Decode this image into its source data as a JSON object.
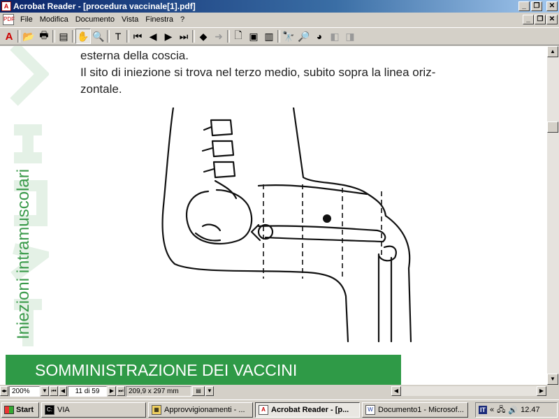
{
  "window": {
    "title": "Acrobat Reader - [procedura vaccinale[1].pdf]",
    "minimize": "_",
    "restore": "❐",
    "close": "✕"
  },
  "menu": {
    "items": [
      "File",
      "Modifica",
      "Documento",
      "Vista",
      "Finestra",
      "?"
    ]
  },
  "toolbar": {
    "icons": [
      "adobe-icon",
      "open-icon",
      "print-icon",
      "show-hide-navigation-icon",
      "hand-tool-icon",
      "zoom-tool-icon",
      "text-select-tool-icon",
      "first-page-icon",
      "previous-page-icon",
      "next-page-icon",
      "last-page-icon",
      "go-back-icon",
      "go-forward-icon",
      "actual-size-icon",
      "fit-page-icon",
      "fit-width-icon",
      "find-icon",
      "search-icon",
      "search-results-icon",
      "previous-highlight-icon",
      "next-highlight-icon"
    ]
  },
  "document": {
    "sidebar_title": "Iniezioni intramuscolari",
    "body_lines": [
      "esterna della coscia.",
      "Il sito di iniezione si trova nel terzo medio, subito sopra la linea oriz-",
      "zontale."
    ],
    "footer_banner": "SOMMINISTRAZIONE DEI VACCINI"
  },
  "status": {
    "zoom": "200%",
    "page": "11 di 59",
    "page_size": "209,9 x 297 mm"
  },
  "taskbar": {
    "start": "Start",
    "tasks": [
      {
        "label": "VIA",
        "icon": "console-icon"
      },
      {
        "label": "Approvvigionamenti - ...",
        "icon": "explorer-icon"
      },
      {
        "label": "Acrobat Reader - [p...",
        "icon": "acrobat-icon",
        "active": true
      },
      {
        "label": "Documento1 - Microsof...",
        "icon": "word-icon"
      }
    ],
    "lang": "IT",
    "clock": "12.47"
  },
  "colors": {
    "title_bar": "#0a246a",
    "brand_green": "#2f9a47",
    "chrome": "#d4d0c8"
  }
}
